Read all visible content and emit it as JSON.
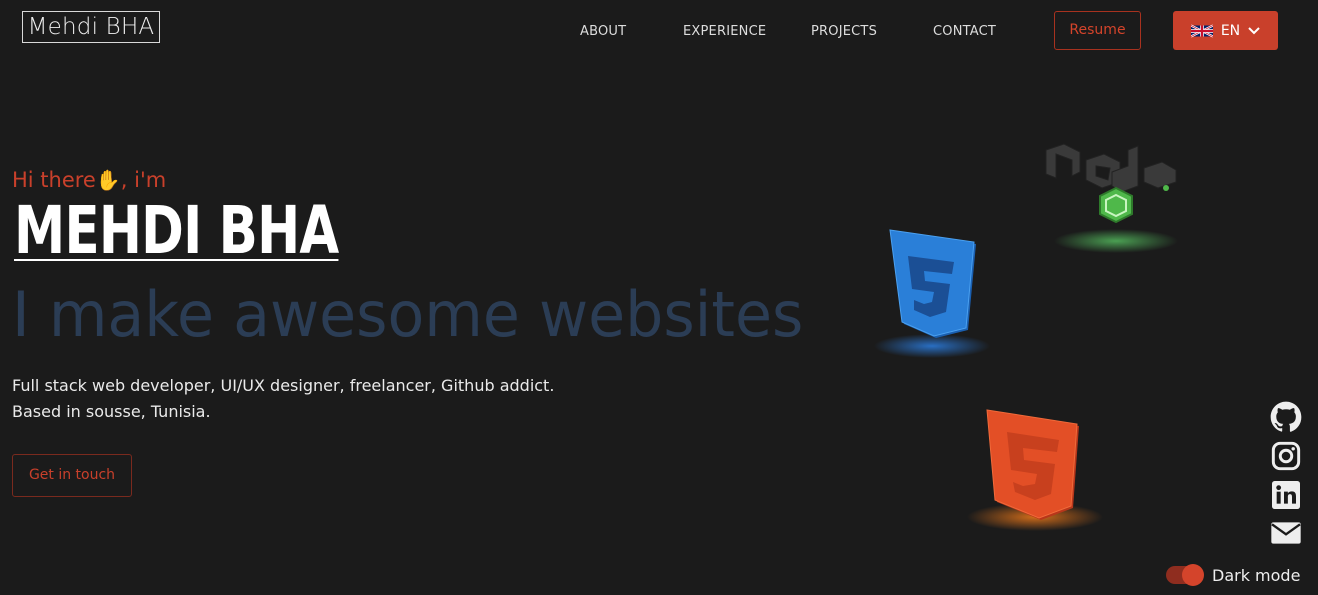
{
  "header": {
    "logo": "Mehdi BHA",
    "nav": [
      "ABOUT",
      "EXPERIENCE",
      "PROJECTS",
      "CONTACT"
    ],
    "resume_label": "Resume",
    "lang_label": "EN",
    "lang_icon": "uk-flag-icon"
  },
  "hero": {
    "greeting_pre": "Hi there",
    "greeting_emoji": "✋",
    "greeting_post": ", i'm",
    "name": "MEHDI BHA",
    "tagline": "I make awesome websites",
    "desc_line1": "Full stack web developer, UI/UX designer, freelancer, Github addict.",
    "desc_line2": "Based in sousse, Tunisia.",
    "cta_label": "Get in touch"
  },
  "social": [
    "github-icon",
    "instagram-icon",
    "linkedin-icon",
    "mail-icon"
  ],
  "theme": {
    "toggle_label": "Dark mode",
    "dark_mode": true,
    "accent": "#c9402b",
    "background": "#1b1b1b"
  },
  "decorations": [
    "node-3d-logo",
    "css3-3d-logo",
    "html5-3d-logo"
  ]
}
